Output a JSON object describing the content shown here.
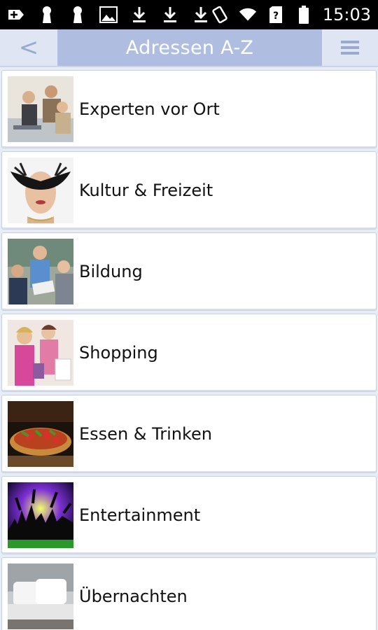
{
  "status_bar": {
    "time": "15:03",
    "icons": [
      "notification-plus-icon",
      "keyhole-icon",
      "keyhole-icon",
      "image-icon",
      "download-icon",
      "download-icon",
      "download-icon",
      "screen-rotation-icon",
      "wifi-icon",
      "sim-unknown-icon",
      "battery-icon"
    ]
  },
  "header": {
    "title": "Adressen A-Z",
    "back_glyph": "<",
    "menu_icon": "hamburger-menu-icon"
  },
  "categories": [
    {
      "label": "Experten vor Ort",
      "image": "business-meeting-photo"
    },
    {
      "label": "Kultur & Freizeit",
      "image": "masked-woman-photo"
    },
    {
      "label": "Bildung",
      "image": "teacher-students-photo"
    },
    {
      "label": "Shopping",
      "image": "shopping-women-photo"
    },
    {
      "label": "Essen & Trinken",
      "image": "pizza-food-photo"
    },
    {
      "label": "Entertainment",
      "image": "party-crowd-photo"
    },
    {
      "label": "Übernachten",
      "image": "hotel-bed-photo"
    }
  ]
}
